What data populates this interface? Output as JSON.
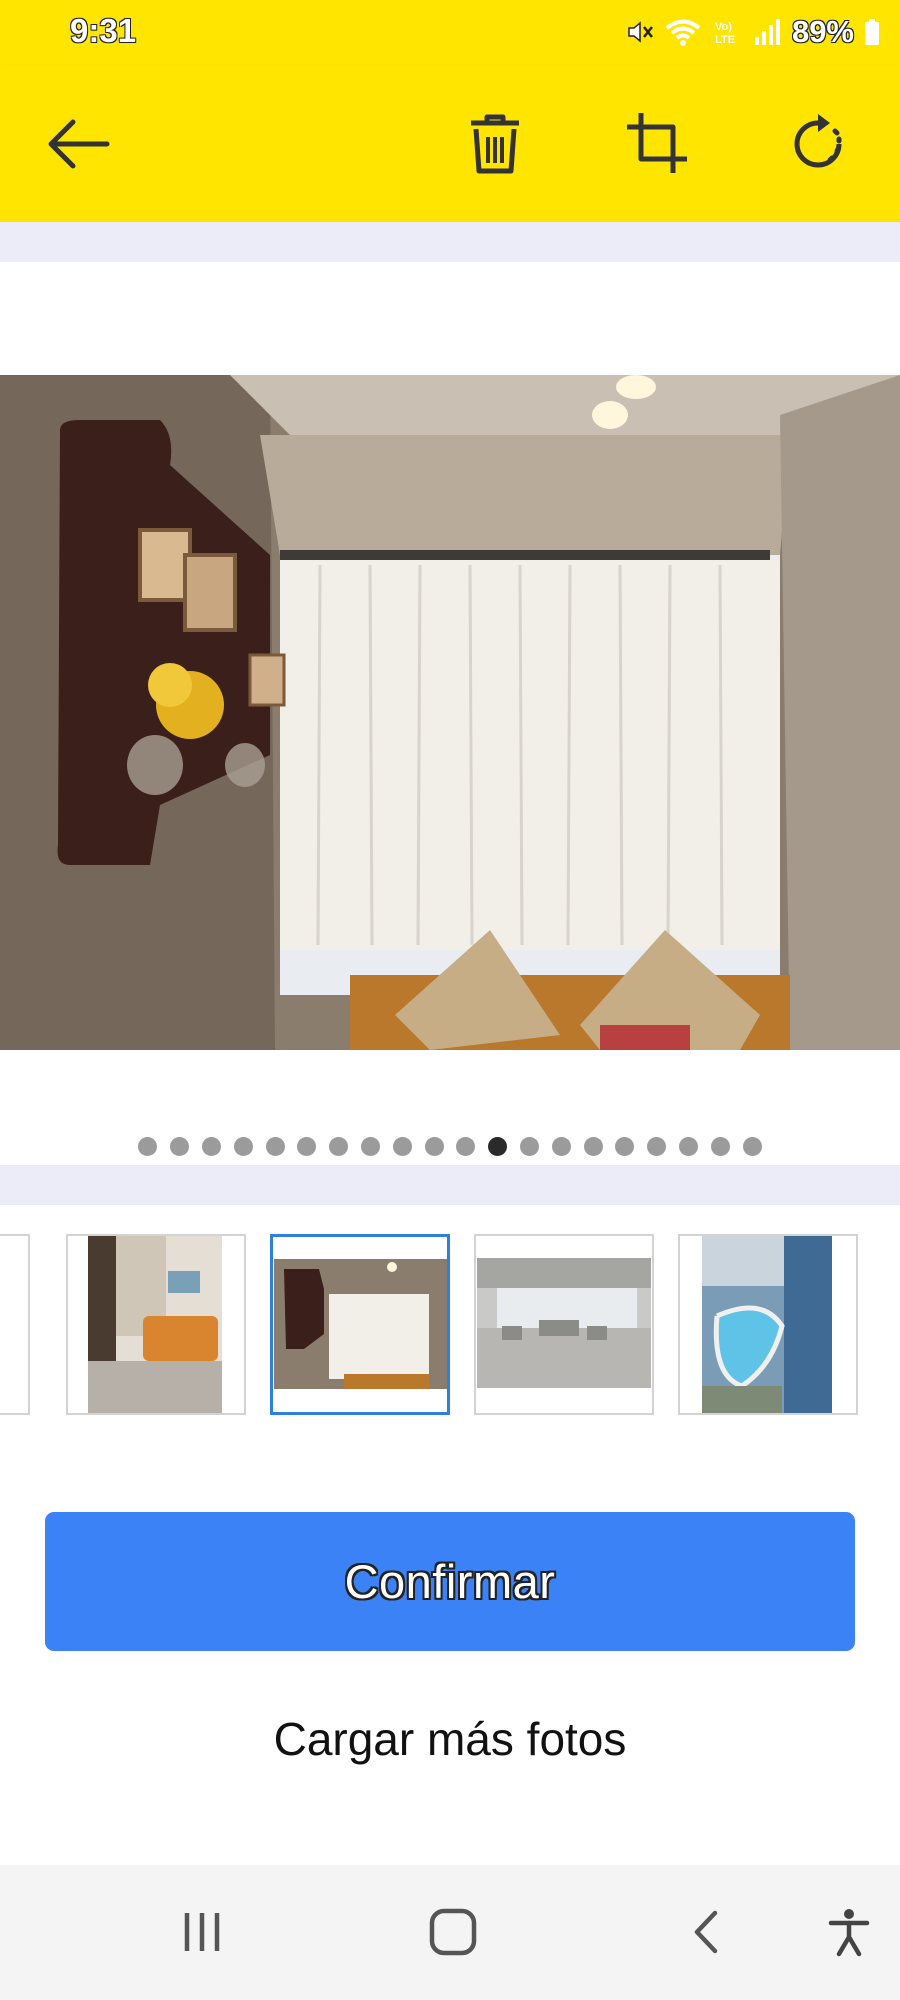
{
  "status_bar": {
    "time": "9:31",
    "battery": "89%",
    "icons": [
      "mute-icon",
      "wifi-icon",
      "volte-icon",
      "signal-icon",
      "battery-icon"
    ]
  },
  "toolbar": {
    "icons": [
      "back-arrow-icon",
      "trash-icon",
      "crop-icon",
      "rotate-icon"
    ],
    "color": "#ffe500"
  },
  "gallery": {
    "total_photos": 20,
    "active_index": 11
  },
  "thumbnails": [
    {
      "content": "living-room-sofa-photo",
      "selected": false
    },
    {
      "content": "room-window-curtains-photo",
      "selected": true
    },
    {
      "content": "lobby-hall-photo",
      "selected": false
    },
    {
      "content": "pool-ocean-photo",
      "selected": false
    }
  ],
  "actions": {
    "confirm_label": "Confirmar",
    "load_more_label": "Cargar más fotos",
    "accent_color": "#3b82f6"
  },
  "navbar": {
    "icons": [
      "recents-icon",
      "home-icon",
      "back-icon",
      "accessibility-icon"
    ]
  }
}
